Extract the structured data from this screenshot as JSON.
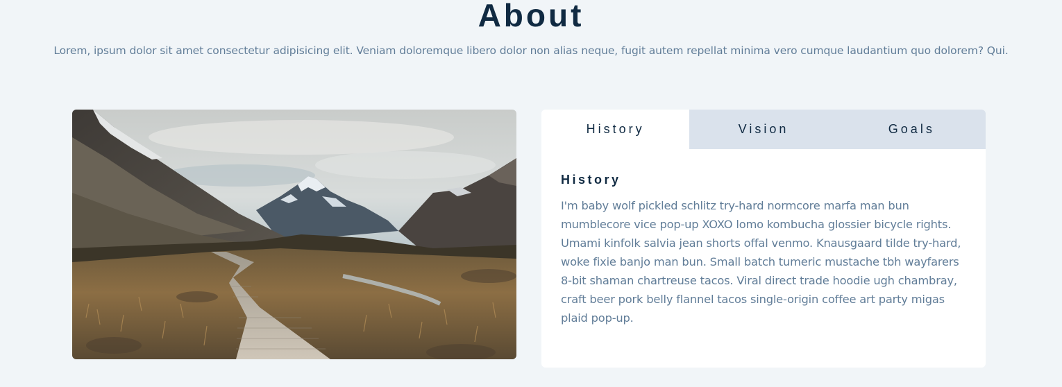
{
  "about": {
    "title": "About",
    "intro": "Lorem, ipsum dolor sit amet consectetur adipisicing elit. Veniam doloremque libero dolor non alias neque, fugit autem repellat minima vero cumque laudantium quo dolorem? Qui."
  },
  "tabs": [
    {
      "label": "History",
      "active": true
    },
    {
      "label": "Vision",
      "active": false
    },
    {
      "label": "Goals",
      "active": false
    }
  ],
  "content": {
    "heading": "History",
    "text": "I'm baby wolf pickled schlitz try-hard normcore marfa man bun mumblecore vice pop-up XOXO lomo kombucha glossier bicycle rights. Umami kinfolk salvia jean shorts offal venmo. Knausgaard tilde try-hard, woke fixie banjo man bun. Small batch tumeric mustache tbh wayfarers 8-bit shaman chartreuse tacos. Viral direct trade hoodie ugh chambray, craft beer pork belly flannel tacos single-origin coffee art party migas plaid pop-up."
  },
  "colors": {
    "background": "#f1f5f8",
    "heading": "#102a42",
    "body_text": "#617d98",
    "tab_inactive": "#dae2ec",
    "card": "#ffffff"
  },
  "image": {
    "icon": "mountain-boardwalk-landscape"
  }
}
